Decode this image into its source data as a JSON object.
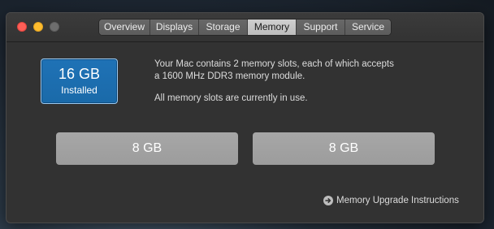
{
  "window": {
    "traffic_lights": [
      "close",
      "minimize",
      "zoom"
    ]
  },
  "tabs": [
    {
      "label": "Overview",
      "active": false
    },
    {
      "label": "Displays",
      "active": false
    },
    {
      "label": "Storage",
      "active": false
    },
    {
      "label": "Memory",
      "active": true
    },
    {
      "label": "Support",
      "active": false
    },
    {
      "label": "Service",
      "active": false
    }
  ],
  "memory": {
    "installed_size": "16 GB",
    "installed_caption": "Installed",
    "description_line1": "Your Mac contains 2 memory slots, each of which accepts",
    "description_line2": "a 1600 MHz DDR3 memory module.",
    "status_text": "All memory slots are currently in use.",
    "slots": [
      {
        "label": "8 GB"
      },
      {
        "label": "8 GB"
      }
    ],
    "upgrade_link": "Memory Upgrade Instructions"
  },
  "colors": {
    "accent": "#1f72b6",
    "close": "#fe5f57",
    "minimize": "#febc2e",
    "zoom_inactive": "#6e6e6e"
  }
}
